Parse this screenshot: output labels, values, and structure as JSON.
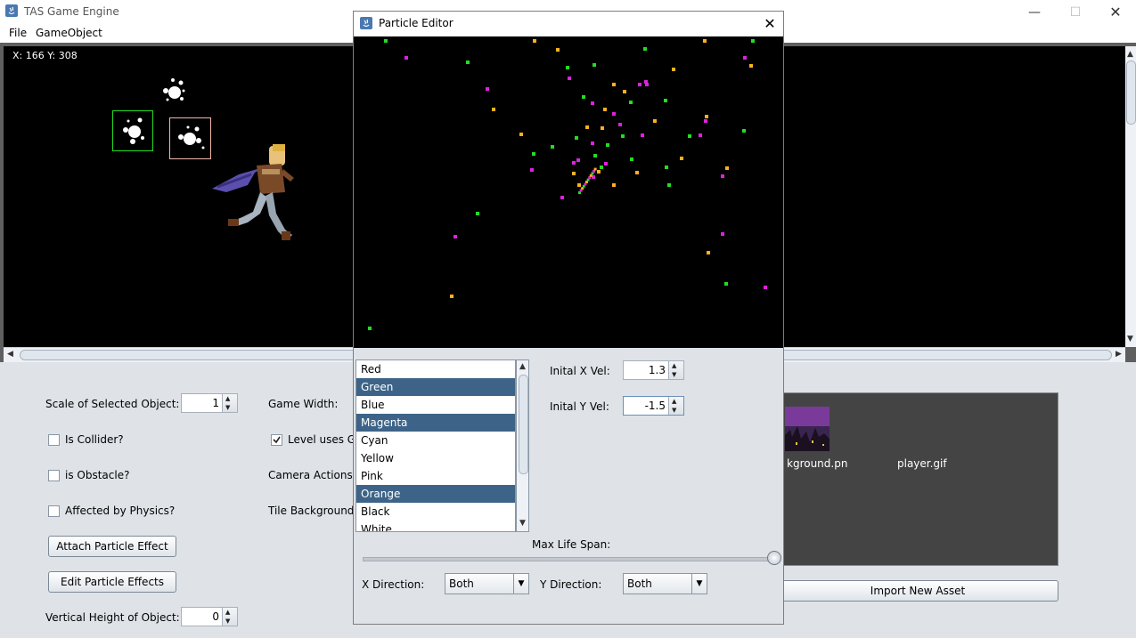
{
  "window": {
    "title": "TAS Game Engine"
  },
  "menu": {
    "items": [
      "File",
      "GameObject"
    ]
  },
  "canvas": {
    "coords": "X: 166 Y: 308"
  },
  "panel": {
    "scale_label": "Scale of Selected Object:",
    "scale_value": "1",
    "game_width_label": "Game Width:",
    "is_collider": "Is Collider?",
    "level_uses": "Level uses G",
    "is_obstacle": "is Obstacle?",
    "camera_actions": "Camera Actions:",
    "affected_physics": "Affected by Physics?",
    "tile_background": "Tile Background:",
    "attach_btn": "Attach Particle Effect",
    "edit_btn": "Edit Particle Effects",
    "vertical_label": "Vertical Height of Object:",
    "vertical_value": "0",
    "import_btn": "Import New Asset"
  },
  "assets": [
    {
      "name": "kground.pn",
      "icon": "background-thumbnail"
    },
    {
      "name": "player.gif",
      "icon": "player-thumbnail"
    }
  ],
  "dialog": {
    "title": "Particle Editor",
    "colors": [
      {
        "label": "Red",
        "selected": false
      },
      {
        "label": "Green",
        "selected": true
      },
      {
        "label": "Blue",
        "selected": false
      },
      {
        "label": "Magenta",
        "selected": true
      },
      {
        "label": "Cyan",
        "selected": false
      },
      {
        "label": "Yellow",
        "selected": false
      },
      {
        "label": "Pink",
        "selected": false
      },
      {
        "label": "Orange",
        "selected": true
      },
      {
        "label": "Black",
        "selected": false
      },
      {
        "label": "White",
        "selected": false
      }
    ],
    "x_vel_label": "Inital X Vel:",
    "x_vel_value": "1.3",
    "y_vel_label": "Inital Y Vel:",
    "y_vel_value": "-1.5",
    "lifespan_label": "Max Life Span:",
    "lifespan_level": 1.0,
    "x_dir_label": "X Direction:",
    "x_dir_value": "Both",
    "y_dir_label": "Y Direction:",
    "y_dir_value": "Both"
  },
  "colors": {
    "selection": "#3d6488",
    "particle_green": "#22dd22",
    "particle_magenta": "#dd22dd",
    "particle_orange": "#ffb020"
  }
}
